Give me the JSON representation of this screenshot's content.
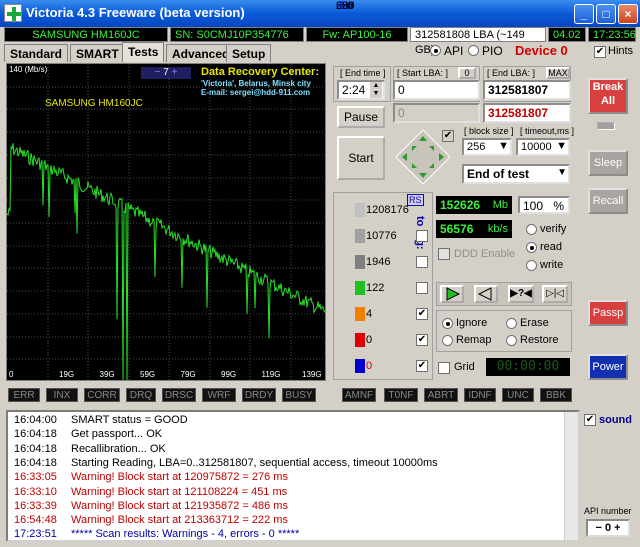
{
  "window": {
    "title": "Victoria 4.3 Freeware (beta version)",
    "buttons": [
      "_",
      "□",
      "×"
    ]
  },
  "info": {
    "model": "SAMSUNG HM160JC",
    "serial": "SN: S0CMJ10P354776",
    "firmware": "Fw: AP100-16",
    "lba": "312581808 LBA (~149 GB)",
    "date": "04.02",
    "time": "17:23:56"
  },
  "tabs": [
    "Standard",
    "SMART",
    "Tests",
    "Advanced",
    "Setup"
  ],
  "mode": {
    "api": "API",
    "pio": "PIO",
    "device": "Device 0",
    "hints": "Hints"
  },
  "graph": {
    "ymax": "140 (Mb/s)",
    "ymin": "0",
    "page": "7",
    "model_label": "SAMSUNG HM160JC",
    "center_title": "Data Recovery Center:",
    "center_l1": "'Victoria', Belarus, Minsk city",
    "center_l2": "E-mail: sergei@hdd-911.com",
    "xlabels": [
      "19G",
      "39G",
      "59G",
      "79G",
      "99G",
      "119G",
      "139G"
    ]
  },
  "controls": {
    "end_time_label": "[ End time ]",
    "end_time": "2:24",
    "start_lba_label": "[ Start LBA: ]",
    "start_lba_zero": "0",
    "start_lba": "0",
    "start_lba_dis": "0",
    "end_lba_label": "[ End LBA: ]",
    "end_lba_max": "MAX",
    "end_lba": "312581807",
    "end_lba2": "312581807",
    "pause": "Pause",
    "start": "Start",
    "block_size_label": "[ block size ]",
    "block_size": "256",
    "timeout_label": "[ timeout,ms ]",
    "timeout": "10000",
    "end_action": "End of test"
  },
  "stats": {
    "rs": "RS",
    "to_log": "to log:",
    "rows": [
      {
        "ms": "5",
        "count": "1208176"
      },
      {
        "ms": "20",
        "count": "10776"
      },
      {
        "ms": "50",
        "count": "1946"
      },
      {
        "ms": "200",
        "count": "122"
      },
      {
        "ms": "600",
        "count": "4"
      },
      {
        "ms": ">",
        "count": "0"
      },
      {
        "ms": "Err",
        "count": "0"
      }
    ]
  },
  "speed": {
    "mb": "152626",
    "mb_unit": "Mb",
    "pct": "100",
    "pct_unit": "%",
    "kbs": "56576",
    "kbs_unit": "kb/s",
    "ddd": "DDD Enable"
  },
  "ops": {
    "verify": "verify",
    "read": "read",
    "write": "write",
    "ignore": "Ignore",
    "erase": "Erase",
    "remap": "Remap",
    "restore": "Restore",
    "grid": "Grid",
    "timer": "00:00:00"
  },
  "errors": [
    "ERR",
    "INX",
    "CORR",
    "DRQ",
    "DRSC",
    "WRF",
    "DRDY",
    "BUSY",
    "AMNF",
    "T0NF",
    "ABRT",
    "IDNF",
    "UNC",
    "BBK"
  ],
  "side": {
    "break": "Break All",
    "sleep": "Sleep",
    "recall": "Recall",
    "passp": "Passp",
    "power": "Power",
    "sound": "sound",
    "api_number_label": "API number",
    "api_number": "0"
  },
  "log": [
    {
      "time": "16:04:00",
      "text": "SMART status = GOOD",
      "kind": "normal"
    },
    {
      "time": "16:04:18",
      "text": "Get passport... OK",
      "kind": "normal"
    },
    {
      "time": "16:04:18",
      "text": "Recallibration... OK",
      "kind": "normal"
    },
    {
      "time": "16:04:18",
      "text": "Starting Reading, LBA=0..312581807, sequential access, timeout 10000ms",
      "kind": "normal"
    },
    {
      "time": "16:33:05",
      "text": "Warning! Block start at 120975872 = 276 ms",
      "kind": "warn"
    },
    {
      "time": "16:33:10",
      "text": "Warning! Block start at 121108224 = 451 ms",
      "kind": "warn"
    },
    {
      "time": "16:33:39",
      "text": "Warning! Block start at 121935872 = 486 ms",
      "kind": "warn"
    },
    {
      "time": "16:54:48",
      "text": "Warning! Block start at 213363712 = 222 ms",
      "kind": "warn"
    },
    {
      "time": "17:23:51",
      "text": "***** Scan results: Warnings - 4, errors - 0 *****",
      "kind": "blue"
    }
  ]
}
